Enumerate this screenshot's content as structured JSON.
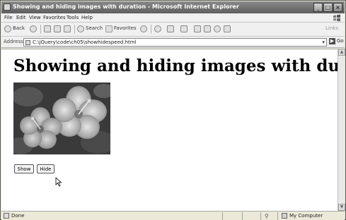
{
  "window": {
    "title": "Showing and hiding images with duration - Microsoft Internet Explorer",
    "min_glyph": "_",
    "max_glyph": "□",
    "close_glyph": "×"
  },
  "menu": {
    "items": [
      "File",
      "Edit",
      "View",
      "Favorites",
      "Tools",
      "Help"
    ]
  },
  "toolbar": {
    "back_label": "Back",
    "search_label": "Search",
    "favorites_label": "Favorites",
    "links_label": "Links"
  },
  "address": {
    "label": "Address",
    "url": "C:\\jQuery\\code\\ch05\\showhidespeed.html",
    "go_label": "Go",
    "dropdown_glyph": "▾",
    "go_arrow": "▶"
  },
  "page": {
    "heading": "Showing and hiding images with duration",
    "image_icon": "hibiscus-flower-image",
    "buttons": {
      "show": "Show",
      "hide": "Hide"
    }
  },
  "scrollbar": {
    "up_glyph": "▲",
    "down_glyph": "▼"
  },
  "status": {
    "text": "Done",
    "zone": "My Computer"
  },
  "colors": {
    "titlebar": "#6e6e6e",
    "chrome": "#ece9d8",
    "content_bg": "#ffffff"
  }
}
